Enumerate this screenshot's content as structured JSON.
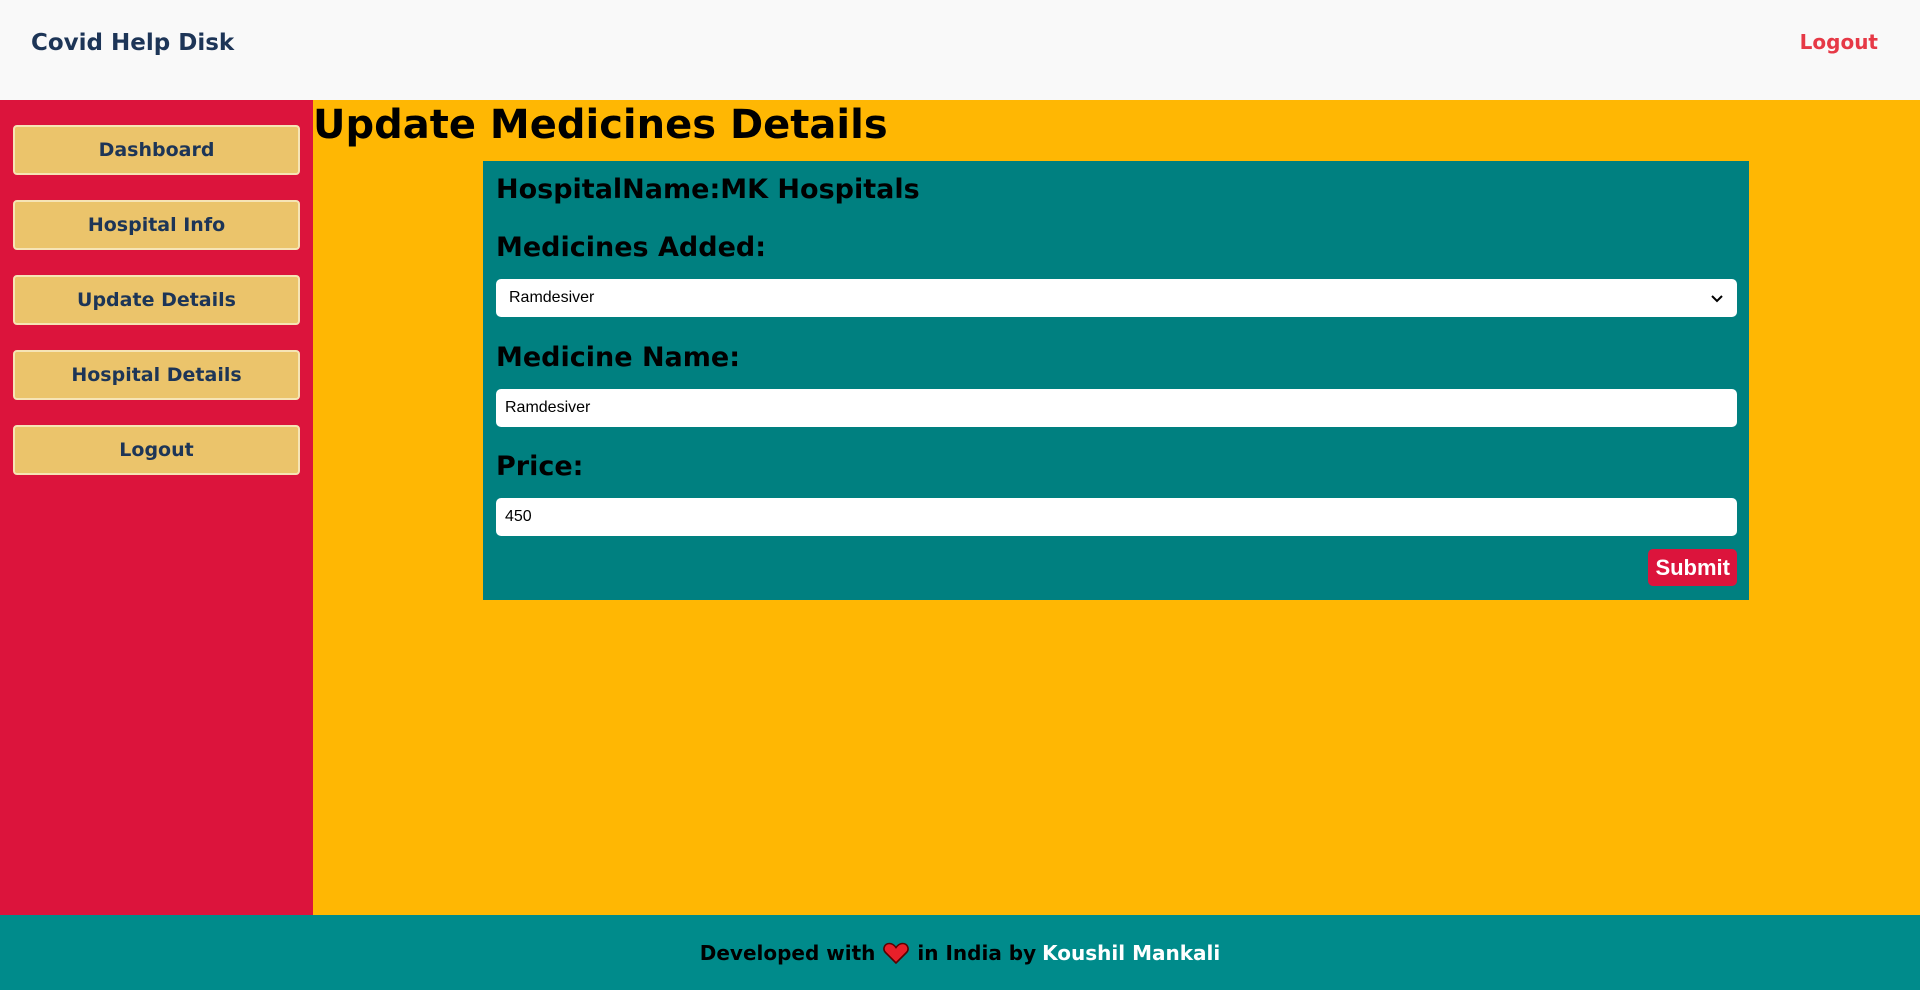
{
  "header": {
    "brand": "Covid Help Disk",
    "logout_label": "Logout"
  },
  "sidebar": {
    "items": [
      {
        "label": "Dashboard"
      },
      {
        "label": "Hospital Info"
      },
      {
        "label": "Update Details"
      },
      {
        "label": "Hospital Details"
      },
      {
        "label": "Logout"
      }
    ]
  },
  "main": {
    "title": "Update Medicines Details",
    "form": {
      "hospital_heading": "HospitalName:MK Hospitals",
      "medicines_added_label": "Medicines Added:",
      "medicines_added_selected": "Ramdesiver",
      "medicine_name_label": "Medicine Name:",
      "medicine_name_value": "Ramdesiver",
      "price_label": "Price:",
      "price_value": "450",
      "submit_label": "Submit"
    }
  },
  "footer": {
    "prefix": "Developed with",
    "middle": "in India by",
    "author": "Koushil Mankali"
  },
  "colors": {
    "header_bg": "#f9f9f9",
    "sidebar_bg": "#dc143c",
    "sidebar_button_bg": "#ebc46b",
    "content_bg": "#ffb703",
    "card_bg": "#008080",
    "footer_bg": "#008b8b",
    "logout_accent": "#e63946",
    "submit_bg": "#dc143c"
  },
  "icons": {
    "select_chevron": "chevron-down-icon",
    "footer_heart": "heart-icon"
  }
}
